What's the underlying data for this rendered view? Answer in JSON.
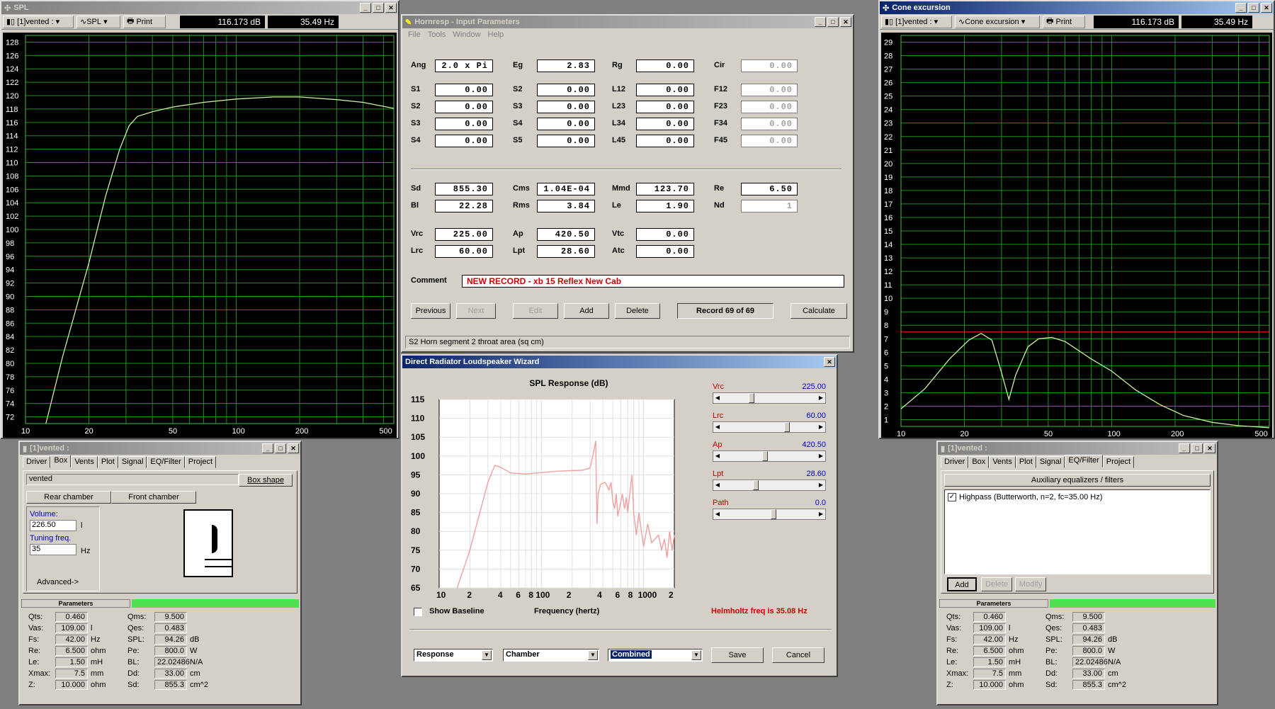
{
  "spl_window": {
    "title": "SPL",
    "record_selector": "[1]vented :",
    "mode_selector": "SPL",
    "print_label": "Print",
    "readout_db": "116.173 dB",
    "readout_hz": "35.49 Hz",
    "y_ticks": [
      "128",
      "126",
      "124",
      "122",
      "120",
      "118",
      "116",
      "114",
      "112",
      "110",
      "108",
      "106",
      "104",
      "102",
      "100",
      "98",
      "96",
      "94",
      "92",
      "90",
      "88",
      "86",
      "84",
      "82",
      "80",
      "78",
      "76",
      "74",
      "72"
    ],
    "x_ticks": [
      "10",
      "20",
      "50",
      "100",
      "200",
      "500"
    ],
    "curve_color": "#c8f0a0"
  },
  "cone_window": {
    "title": "Cone excursion",
    "record_selector": "[1]vented :",
    "mode_selector": "Cone excursion",
    "print_label": "Print",
    "readout_db": "116.173 dB",
    "readout_hz": "35.49 Hz",
    "y_ticks": [
      "29",
      "28",
      "27",
      "26",
      "25",
      "24",
      "23",
      "22",
      "21",
      "20",
      "19",
      "18",
      "17",
      "16",
      "15",
      "14",
      "13",
      "12",
      "11",
      "10",
      "9",
      "8",
      "7",
      "6",
      "5",
      "4",
      "3",
      "2",
      "1"
    ],
    "x_ticks": [
      "10",
      "20",
      "50",
      "100",
      "200",
      "500"
    ],
    "xmax_line_color": "#ff2020"
  },
  "input_window": {
    "title": "Hornresp - Input Parameters",
    "menu": [
      "File",
      "Tools",
      "Window",
      "Help"
    ],
    "rows1": [
      {
        "l1": "Ang",
        "v1": "2.0 x Pi",
        "l2": "Eg",
        "v2": "2.83",
        "l3": "Rg",
        "v3": "0.00",
        "l4": "Cir",
        "v4": "0.00"
      }
    ],
    "rows2": [
      {
        "l1": "S1",
        "v1": "0.00",
        "l2": "S2",
        "v2": "0.00",
        "l3": "L12",
        "v3": "0.00",
        "l4": "F12",
        "v4": "0.00"
      },
      {
        "l1": "S2",
        "v1": "0.00",
        "l2": "S3",
        "v2": "0.00",
        "l3": "L23",
        "v3": "0.00",
        "l4": "F23",
        "v4": "0.00"
      },
      {
        "l1": "S3",
        "v1": "0.00",
        "l2": "S4",
        "v2": "0.00",
        "l3": "L34",
        "v3": "0.00",
        "l4": "F34",
        "v4": "0.00"
      },
      {
        "l1": "S4",
        "v1": "0.00",
        "l2": "S5",
        "v2": "0.00",
        "l3": "L45",
        "v3": "0.00",
        "l4": "F45",
        "v4": "0.00"
      }
    ],
    "rows3": [
      {
        "l1": "Sd",
        "v1": "855.30",
        "l2": "Cms",
        "v2": "1.04E-04",
        "l3": "Mmd",
        "v3": "123.70",
        "l4": "Re",
        "v4": "6.50"
      },
      {
        "l1": "Bl",
        "v1": "22.28",
        "l2": "Rms",
        "v2": "3.84",
        "l3": "Le",
        "v3": "1.90",
        "l4": "Nd",
        "v4": "1"
      }
    ],
    "rows4": [
      {
        "l1": "Vrc",
        "v1": "225.00",
        "l2": "Ap",
        "v2": "420.50",
        "l3": "Vtc",
        "v3": "0.00"
      },
      {
        "l1": "Lrc",
        "v1": "60.00",
        "l2": "Lpt",
        "v2": "28.60",
        "l3": "Atc",
        "v3": "0.00"
      }
    ],
    "comment_label": "Comment",
    "comment_value": "NEW RECORD - xb 15 Reflex New Cab",
    "buttons": {
      "previous": "Previous",
      "next": "Next",
      "edit": "Edit",
      "add": "Add",
      "delete": "Delete",
      "record": "Record 69 of 69",
      "calculate": "Calculate"
    },
    "status": "S2   Horn segment 2 throat area  (sq cm)"
  },
  "wizard": {
    "title": "Direct Radiator Loudspeaker Wizard",
    "chart_title": "SPL Response (dB)",
    "y_ticks": [
      "115",
      "110",
      "105",
      "100",
      "95",
      "90",
      "85",
      "80",
      "75",
      "70",
      "65"
    ],
    "x_ticks": [
      "10",
      "2",
      "4",
      "6",
      "8",
      "100",
      "2",
      "4",
      "6",
      "8",
      "1000",
      "2"
    ],
    "sliders": [
      {
        "label": "Vrc",
        "value": "225.00",
        "pos": 0.3
      },
      {
        "label": "Lrc",
        "value": "60.00",
        "pos": 0.7
      },
      {
        "label": "Ap",
        "value": "420.50",
        "pos": 0.45
      },
      {
        "label": "Lpt",
        "value": "28.60",
        "pos": 0.35
      },
      {
        "label": "Path",
        "value": "0.0",
        "pos": 0.55
      }
    ],
    "show_baseline": "Show Baseline",
    "x_axis_label": "Frequency (hertz)",
    "helmholtz": "Helmholtz freq is 35.08 Hz",
    "select1": "Response",
    "select2": "Chamber",
    "select3": "Combined",
    "save": "Save",
    "cancel": "Cancel",
    "curve_color": "#f0a0a0"
  },
  "box_window": {
    "title": "[1]vented :",
    "tabs": [
      "Driver",
      "Box",
      "Vents",
      "Plot",
      "Signal",
      "EQ/Filter",
      "Project"
    ],
    "selected_tab": "Box",
    "box_name": "vented",
    "box_shape": "Box shape",
    "rear": "Rear chamber",
    "front": "Front chamber",
    "volume_label": "Volume:",
    "volume_value": "226.50",
    "volume_unit": "l",
    "tuning_label": "Tuning freq.",
    "tuning_value": "35",
    "tuning_unit": "Hz",
    "advanced": "Advanced->"
  },
  "eq_window": {
    "title": "[1]vented :",
    "tabs": [
      "Driver",
      "Box",
      "Vents",
      "Plot",
      "Signal",
      "EQ/Filter",
      "Project"
    ],
    "selected_tab": "EQ/Filter",
    "header": "Auxiliary equalizers / filters",
    "item": "Highpass (Butterworth, n=2, fc=35.00 Hz)",
    "add": "Add",
    "delete": "Delete",
    "modify": "Modify"
  },
  "parameters": {
    "header": "Parameters",
    "left": [
      {
        "k": "Qts:",
        "v": "0.460",
        "u": ""
      },
      {
        "k": "Vas:",
        "v": "109.00",
        "u": "l"
      },
      {
        "k": "Fs:",
        "v": "42.00",
        "u": "Hz"
      },
      {
        "k": "Re:",
        "v": "6.500",
        "u": "ohm"
      },
      {
        "k": "Le:",
        "v": "1.50",
        "u": "mH"
      },
      {
        "k": "Xmax:",
        "v": "7.5",
        "u": "mm"
      },
      {
        "k": "Z:",
        "v": "10.000",
        "u": "ohm"
      }
    ],
    "right": [
      {
        "k": "Qms:",
        "v": "9.500",
        "u": ""
      },
      {
        "k": "Qes:",
        "v": "0.483",
        "u": ""
      },
      {
        "k": "SPL:",
        "v": "94.26",
        "u": "dB"
      },
      {
        "k": "Pe:",
        "v": "800.0",
        "u": "W"
      },
      {
        "k": "BL:",
        "v": "22.02486",
        "u": "N/A"
      },
      {
        "k": "Dd:",
        "v": "33.00",
        "u": "cm"
      },
      {
        "k": "Sd:",
        "v": "855.3",
        "u": "cm^2"
      }
    ]
  }
}
